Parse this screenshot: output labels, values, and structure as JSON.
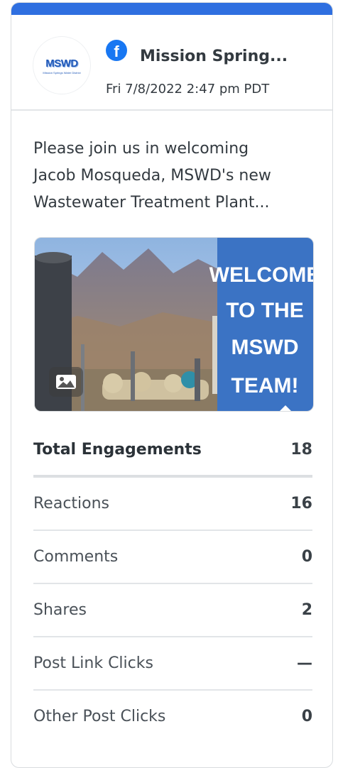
{
  "post": {
    "account_name": "Mission Spring...",
    "timestamp": "Fri 7/8/2022 2:47 pm PDT",
    "avatar_logo": "MSWD",
    "avatar_subtext": "Mission Springs Water District",
    "network_icon": "facebook-icon",
    "text_lines": [
      "Please join us in welcoming",
      "Jacob Mosqueda, MSWD's new",
      "Wastewater Treatment Plant..."
    ],
    "image_banner_lines": [
      "WELCOME",
      "TO THE",
      "MSWD",
      "TEAM!"
    ],
    "media_type_icon": "image-icon"
  },
  "metrics": {
    "total": {
      "label": "Total Engagements",
      "value": "18"
    },
    "rows": [
      {
        "label": "Reactions",
        "value": "16"
      },
      {
        "label": "Comments",
        "value": "0"
      },
      {
        "label": "Shares",
        "value": "2"
      },
      {
        "label": "Post Link Clicks",
        "value": "—"
      },
      {
        "label": "Other Post Clicks",
        "value": "0"
      }
    ]
  },
  "colors": {
    "topbar": "#2f6fe0",
    "facebook": "#1877f2",
    "banner": "#3b73c4"
  }
}
